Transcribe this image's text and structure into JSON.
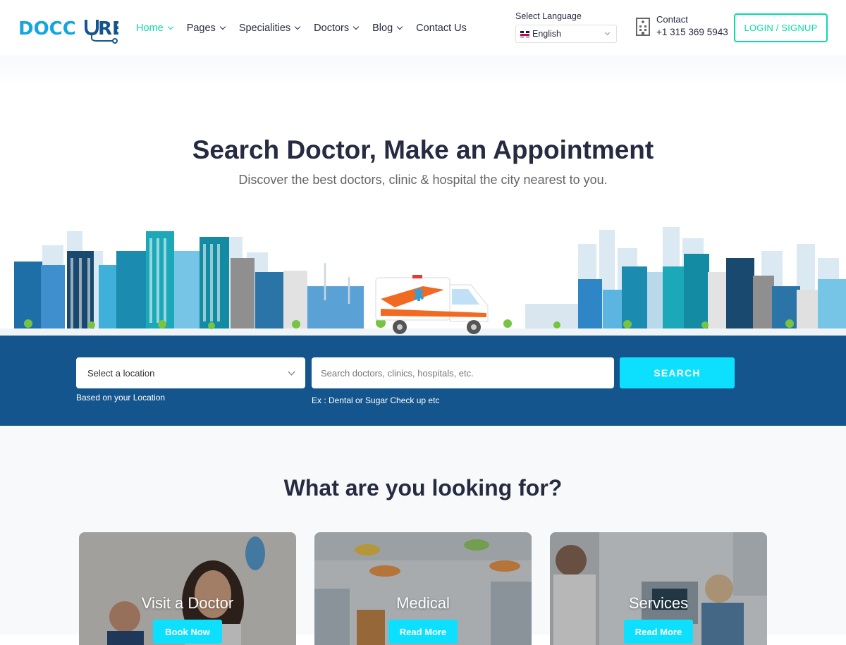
{
  "header": {
    "logo_text_a": "DOCC",
    "logo_text_b": "RE",
    "nav": [
      {
        "label": "Home"
      },
      {
        "label": "Pages"
      },
      {
        "label": "Specialities"
      },
      {
        "label": "Doctors"
      },
      {
        "label": "Blog"
      },
      {
        "label": "Contact Us"
      }
    ],
    "language": {
      "label": "Select Language",
      "selected": "English"
    },
    "contact": {
      "label": "Contact",
      "phone": "+1 315 369 5943"
    },
    "login_label": "LOGIN / SIGNUP"
  },
  "hero": {
    "title": "Search Doctor, Make an Appointment",
    "subtitle": "Discover the best doctors, clinic & hospital the city nearest to you."
  },
  "search": {
    "location_placeholder": "Select a location",
    "location_hint": "Based on your Location",
    "query_placeholder": "Search doctors, clinics, hospitals, etc.",
    "query_hint": "Ex : Dental or Sugar Check up etc",
    "button_label": "SEARCH"
  },
  "looking": {
    "title": "What are you looking for?",
    "cards": [
      {
        "title": "Visit a Doctor",
        "button": "Book Now"
      },
      {
        "title": "Medical",
        "button": "Read More"
      },
      {
        "title": "Services",
        "button": "Read More"
      }
    ]
  },
  "colors": {
    "accent_green": "#09dca4",
    "accent_cyan": "#0de0fe",
    "brand_blue": "#15558d",
    "text_dark": "#272b41"
  }
}
